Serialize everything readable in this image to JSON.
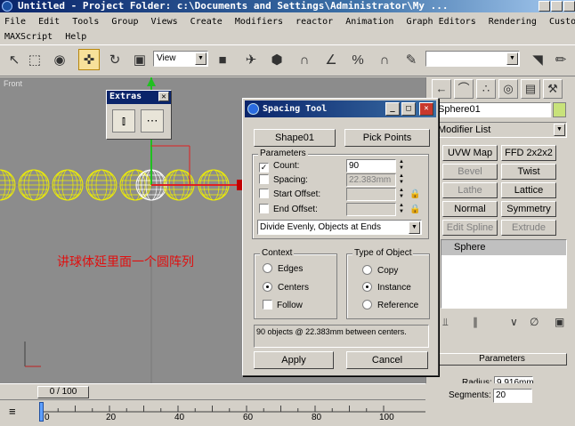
{
  "window": {
    "title": "Untitled   - Project Folder: c:\\Documents and Settings\\Administrator\\My ..."
  },
  "menu": {
    "row1": [
      "File",
      "Edit",
      "Tools",
      "Group",
      "Views",
      "Create",
      "Modifiers",
      "reactor",
      "Animation",
      "Graph Editors",
      "Rendering",
      "Customize"
    ],
    "row2": [
      "MAXScript",
      "Help"
    ]
  },
  "toolbar": {
    "view_select": "View",
    "icons": [
      "select-icon",
      "region-select-icon",
      "window-crossing-icon",
      "move-icon",
      "rotate-icon",
      "scale-icon",
      "use-pivot-icon",
      "manipulate-icon",
      "snap-icon",
      "angle-snap-icon",
      "percent-snap-icon",
      "spinner-snap-icon",
      "named-selection-icon",
      "mirror-icon",
      "align-icon"
    ]
  },
  "viewport": {
    "label": "Front",
    "note": "讲球体延里面一个圆阵列"
  },
  "extras": {
    "title": "Extras"
  },
  "spacing_tool": {
    "title": "Spacing Tool",
    "shape_button": "Shape01",
    "pick_points_button": "Pick Points",
    "parameters_label": "Parameters",
    "count_label": "Count:",
    "count_value": "90",
    "count_checked": true,
    "spacing_label": "Spacing:",
    "spacing_value": "22.383mm",
    "start_offset_label": "Start Offset:",
    "end_offset_label": "End Offset:",
    "distribution": "Divide Evenly, Objects at Ends",
    "context_label": "Context",
    "context_options": [
      "Edges",
      "Centers",
      "Follow"
    ],
    "context_selected": "Centers",
    "type_label": "Type of Object",
    "type_options": [
      "Copy",
      "Instance",
      "Reference"
    ],
    "type_selected": "Instance",
    "status_text": "90 objects @ 22.383mm  between centers.",
    "apply_button": "Apply",
    "cancel_button": "Cancel"
  },
  "command_panel": {
    "object_name": "Sphere01",
    "modifier_list": "Modifier List",
    "modifier_buttons": [
      {
        "label": "UVW Map",
        "enabled": true
      },
      {
        "label": "FFD 2x2x2",
        "enabled": true
      },
      {
        "label": "Bevel",
        "enabled": false
      },
      {
        "label": "Twist",
        "enabled": true
      },
      {
        "label": "Lathe",
        "enabled": false
      },
      {
        "label": "Lattice",
        "enabled": true
      },
      {
        "label": "Normal",
        "enabled": true
      },
      {
        "label": "Symmetry",
        "enabled": true
      },
      {
        "label": "Edit Spline",
        "enabled": false
      },
      {
        "label": "Extrude",
        "enabled": false
      }
    ],
    "stack_item": "Sphere",
    "parameters_rollout": "Parameters",
    "radius_label": "Radius:",
    "radius_value": "9.916mm",
    "segments_label": "Segments:",
    "segments_value": "20"
  },
  "timeline": {
    "frame_display": "0 / 100",
    "ticks": [
      "0",
      "20",
      "40",
      "60",
      "80",
      "100"
    ]
  },
  "colors": {
    "title_bar": "#0a246a",
    "highlight": "#f7e19a",
    "viewport_bg": "#8c8c8c",
    "spheres": "#f0f000",
    "selected_sphere": "#ffffff",
    "note_text": "#e01010"
  }
}
